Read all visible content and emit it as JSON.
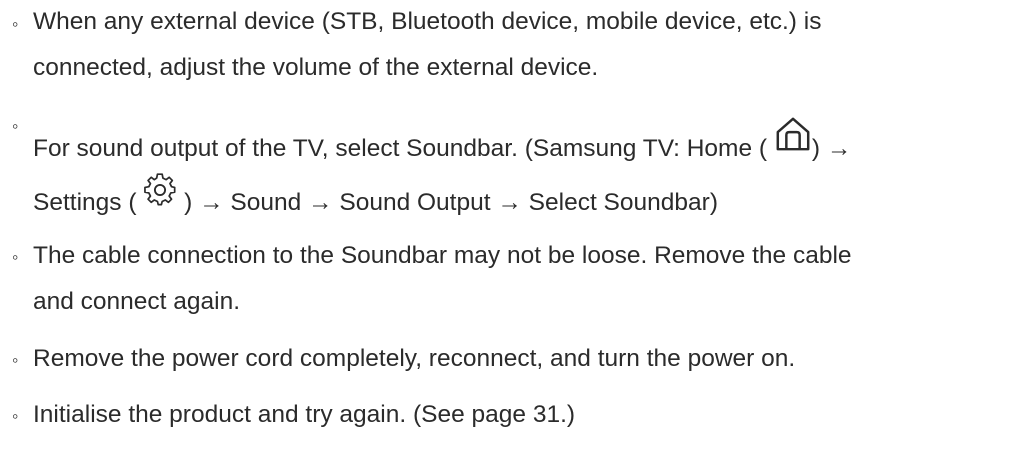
{
  "items": [
    {
      "lines": [
        "When any external device (STB, Bluetooth device, mobile device, etc.) is",
        "connected, adjust the volume of the external device."
      ]
    },
    {
      "line1_a": "For sound output of the TV, select Soundbar. (Samsung TV: Home ( ",
      "line1_b": ") →",
      "line2_a": "Settings ( ",
      "line2_b": " ) → Sound → Sound Output → Select Soundbar)",
      "icons": [
        "home-icon",
        "gear-icon"
      ]
    },
    {
      "lines": [
        "The cable connection to the Soundbar may not be loose. Remove the cable",
        "and connect again."
      ]
    },
    {
      "lines": [
        "Remove the power cord completely, reconnect, and turn the power on."
      ]
    },
    {
      "lines": [
        "Initialise the product and try again. (See page 31.)"
      ]
    }
  ],
  "bullet_char": "◦"
}
